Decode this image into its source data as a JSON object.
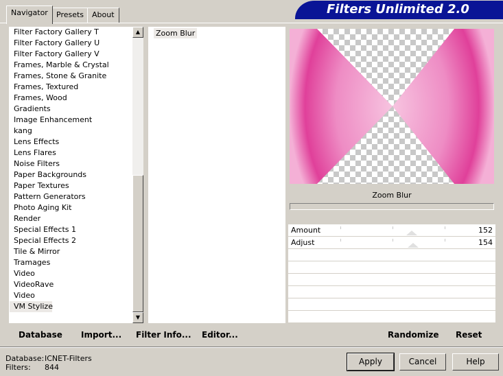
{
  "tabs": [
    {
      "label": "Navigator",
      "active": true
    },
    {
      "label": "Presets",
      "active": false
    },
    {
      "label": "About",
      "active": false
    }
  ],
  "banner": {
    "title": "Filters Unlimited 2.0"
  },
  "categories": [
    "Filter Factory Gallery T",
    "Filter Factory Gallery U",
    "Filter Factory Gallery V",
    "Frames, Marble & Crystal",
    "Frames, Stone & Granite",
    "Frames, Textured",
    "Frames, Wood",
    "Gradients",
    "Image Enhancement",
    "kang",
    "Lens Effects",
    "Lens Flares",
    "Noise Filters",
    "Paper Backgrounds",
    "Paper Textures",
    "Pattern Generators",
    "Photo Aging Kit",
    "Render",
    "Special Effects 1",
    "Special Effects 2",
    "Tile & Mirror",
    "Tramages",
    "Video",
    "VideoRave",
    "Video",
    "VM Stylize"
  ],
  "selected_category": "VM Stylize",
  "filters": [
    "Zoom Blur"
  ],
  "effect_name": "Zoom Blur",
  "params": [
    {
      "label": "Amount",
      "value": "152"
    },
    {
      "label": "Adjust",
      "value": "154"
    }
  ],
  "actions": {
    "database": "Database",
    "import": "Import...",
    "filter_info": "Filter Info...",
    "editor": "Editor...",
    "randomize": "Randomize",
    "reset": "Reset"
  },
  "info": {
    "database_label": "Database:",
    "database_value": "ICNET-Filters",
    "filters_label": "Filters:",
    "filters_value": "844"
  },
  "buttons": {
    "apply": "Apply",
    "cancel": "Cancel",
    "help": "Help"
  },
  "colors": {
    "banner": "#0a1496",
    "accent_pink": "#e0409a",
    "face": "#d4d0c8"
  },
  "icons": {
    "scroll_up": "▲",
    "scroll_down": "▼"
  }
}
